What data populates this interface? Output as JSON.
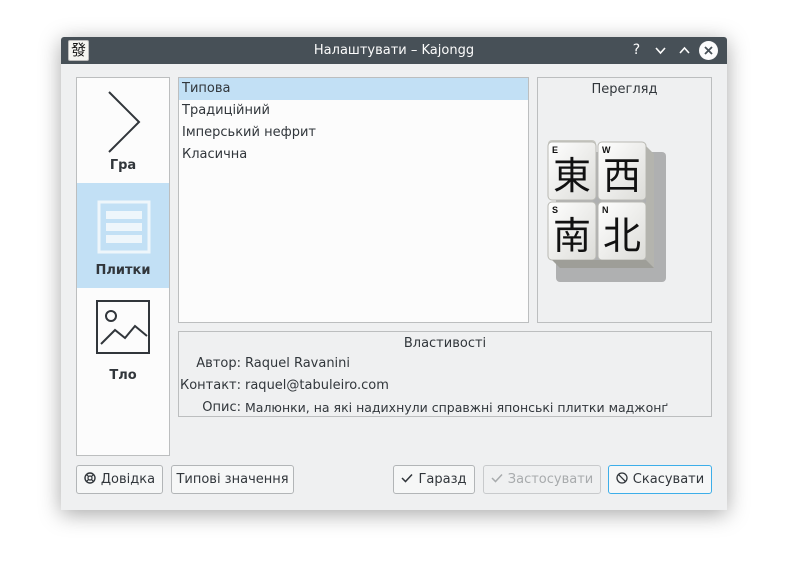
{
  "window": {
    "title": "Налаштувати – Kajongg",
    "app_icon": "發",
    "controls": {
      "help": "?",
      "minimize": "⌄",
      "maximize": "⌃",
      "close": "✕"
    }
  },
  "sidebar": {
    "items": [
      {
        "label": "Гра",
        "icon": "chevron-right-icon",
        "active": false
      },
      {
        "label": "Плитки",
        "icon": "tiles-icon",
        "active": true
      },
      {
        "label": "Тло",
        "icon": "image-icon",
        "active": false
      }
    ]
  },
  "tilesets": {
    "items": [
      "Типова",
      "Традиційний",
      "Імперський нефрит",
      "Класична"
    ],
    "selected": "Типова"
  },
  "preview": {
    "title": "Перегляд",
    "tiles": [
      {
        "corner": "E",
        "glyph": "東"
      },
      {
        "corner": "W",
        "glyph": "西"
      },
      {
        "corner": "S",
        "glyph": "南"
      },
      {
        "corner": "N",
        "glyph": "北"
      }
    ]
  },
  "properties": {
    "title": "Властивості",
    "author_label": "Автор:",
    "author": "Raquel Ravanini",
    "contact_label": "Контакт:",
    "contact": "raquel@tabuleiro.com",
    "description_label": "Опис:",
    "description": "Малюнки, на які надихнули справжні японські плитки маджонґ"
  },
  "buttons": {
    "help": "Довідка",
    "defaults": "Типові значення",
    "ok": "Гаразд",
    "apply": "Застосувати",
    "cancel": "Скасувати"
  },
  "colors": {
    "titlebar": "#475057",
    "selection": "#c2e0f5",
    "focus": "#3daee9"
  }
}
